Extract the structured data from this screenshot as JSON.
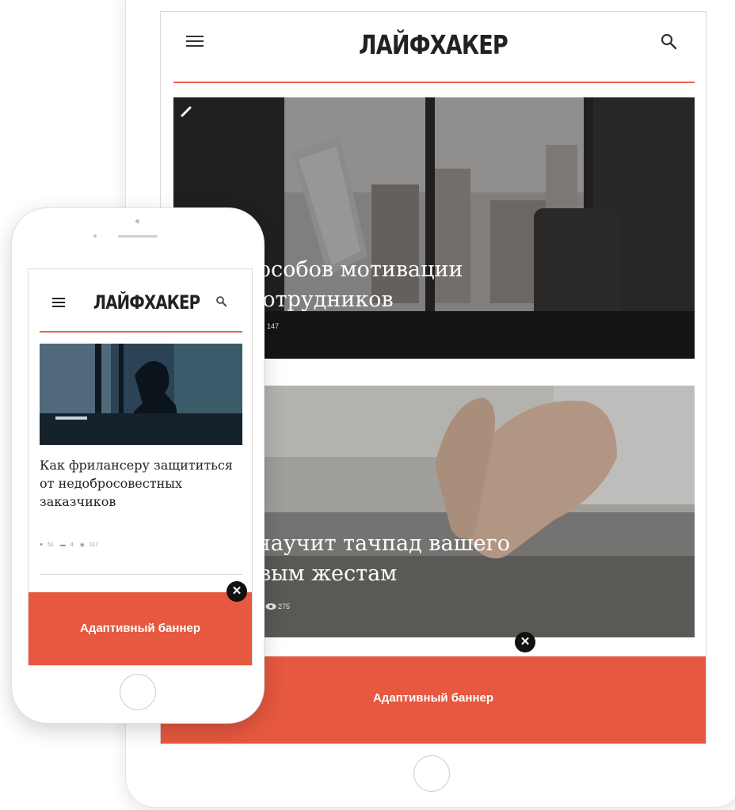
{
  "tablet": {
    "logo": "ЛАЙФХАКЕР",
    "articles": [
      {
        "title_line1": "тких способов мотивации",
        "title_line2": "енных сотрудников",
        "views": "147"
      },
      {
        "title_line1": "ows 10 научит тачпад вашего",
        "title_line2": "бука новым жестам",
        "views": "275"
      }
    ],
    "banner": "Адаптивный баннер"
  },
  "phone": {
    "logo": "ЛАЙФХАКЕР",
    "article": {
      "title": "Как фрилансеру защититься от недобросовестных заказчиков",
      "likes": "51",
      "comments": "4",
      "views": "117"
    },
    "banner": "Адаптивный баннер"
  },
  "colors": {
    "accent": "#e6583f",
    "rule": "#e8624a"
  },
  "icons": [
    "menu-icon",
    "search-icon",
    "close-icon",
    "pencil-icon",
    "heart-icon",
    "comment-icon",
    "eye-icon"
  ]
}
